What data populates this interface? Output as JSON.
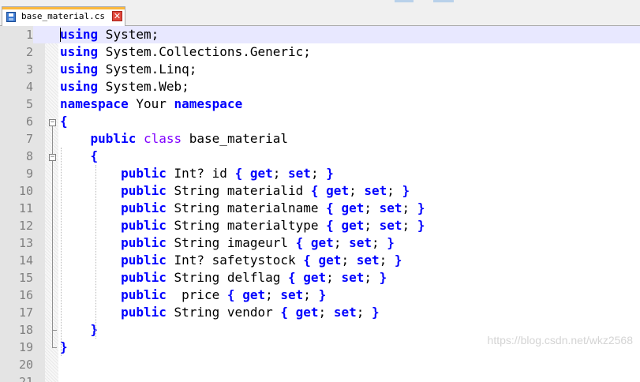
{
  "tab": {
    "title": "base_material.cs",
    "close_symbol": "✕",
    "icon": "save-file-icon"
  },
  "editor": {
    "lines": [
      {
        "n": "1",
        "tokens": [
          {
            "t": "using",
            "c": "kw"
          },
          {
            "t": " System;",
            "c": "id"
          }
        ]
      },
      {
        "n": "2",
        "tokens": [
          {
            "t": "using",
            "c": "kw"
          },
          {
            "t": " System.Collections.Generic;",
            "c": "id"
          }
        ]
      },
      {
        "n": "3",
        "tokens": [
          {
            "t": "using",
            "c": "kw"
          },
          {
            "t": " System.Linq;",
            "c": "id"
          }
        ]
      },
      {
        "n": "4",
        "tokens": [
          {
            "t": "using",
            "c": "kw"
          },
          {
            "t": " System.Web;",
            "c": "id"
          }
        ]
      },
      {
        "n": "5",
        "tokens": [
          {
            "t": "namespace",
            "c": "kw"
          },
          {
            "t": " Your ",
            "c": "id"
          },
          {
            "t": "namespace",
            "c": "kw"
          }
        ]
      },
      {
        "n": "6",
        "tokens": [
          {
            "t": "{",
            "c": "br"
          }
        ]
      },
      {
        "n": "7",
        "tokens": [
          {
            "t": "    ",
            "c": "id"
          },
          {
            "t": "public",
            "c": "kw"
          },
          {
            "t": " ",
            "c": "id"
          },
          {
            "t": "class",
            "c": "ty"
          },
          {
            "t": " base_material",
            "c": "id"
          }
        ]
      },
      {
        "n": "8",
        "tokens": [
          {
            "t": "    ",
            "c": "id"
          },
          {
            "t": "{",
            "c": "br"
          }
        ]
      },
      {
        "n": "9",
        "tokens": [
          {
            "t": "        ",
            "c": "id"
          },
          {
            "t": "public",
            "c": "kw"
          },
          {
            "t": " Int? id ",
            "c": "id"
          },
          {
            "t": "{",
            "c": "br"
          },
          {
            "t": " ",
            "c": "id"
          },
          {
            "t": "get",
            "c": "kw"
          },
          {
            "t": ";",
            "c": "id"
          },
          {
            "t": " ",
            "c": "id"
          },
          {
            "t": "set",
            "c": "kw"
          },
          {
            "t": ";",
            "c": "id"
          },
          {
            "t": " ",
            "c": "id"
          },
          {
            "t": "}",
            "c": "br"
          }
        ]
      },
      {
        "n": "10",
        "tokens": [
          {
            "t": "        ",
            "c": "id"
          },
          {
            "t": "public",
            "c": "kw"
          },
          {
            "t": " String materialid ",
            "c": "id"
          },
          {
            "t": "{",
            "c": "br"
          },
          {
            "t": " ",
            "c": "id"
          },
          {
            "t": "get",
            "c": "kw"
          },
          {
            "t": ";",
            "c": "id"
          },
          {
            "t": " ",
            "c": "id"
          },
          {
            "t": "set",
            "c": "kw"
          },
          {
            "t": ";",
            "c": "id"
          },
          {
            "t": " ",
            "c": "id"
          },
          {
            "t": "}",
            "c": "br"
          }
        ]
      },
      {
        "n": "11",
        "tokens": [
          {
            "t": "        ",
            "c": "id"
          },
          {
            "t": "public",
            "c": "kw"
          },
          {
            "t": " String materialname ",
            "c": "id"
          },
          {
            "t": "{",
            "c": "br"
          },
          {
            "t": " ",
            "c": "id"
          },
          {
            "t": "get",
            "c": "kw"
          },
          {
            "t": ";",
            "c": "id"
          },
          {
            "t": " ",
            "c": "id"
          },
          {
            "t": "set",
            "c": "kw"
          },
          {
            "t": ";",
            "c": "id"
          },
          {
            "t": " ",
            "c": "id"
          },
          {
            "t": "}",
            "c": "br"
          }
        ]
      },
      {
        "n": "12",
        "tokens": [
          {
            "t": "        ",
            "c": "id"
          },
          {
            "t": "public",
            "c": "kw"
          },
          {
            "t": " String materialtype ",
            "c": "id"
          },
          {
            "t": "{",
            "c": "br"
          },
          {
            "t": " ",
            "c": "id"
          },
          {
            "t": "get",
            "c": "kw"
          },
          {
            "t": ";",
            "c": "id"
          },
          {
            "t": " ",
            "c": "id"
          },
          {
            "t": "set",
            "c": "kw"
          },
          {
            "t": ";",
            "c": "id"
          },
          {
            "t": " ",
            "c": "id"
          },
          {
            "t": "}",
            "c": "br"
          }
        ]
      },
      {
        "n": "13",
        "tokens": [
          {
            "t": "        ",
            "c": "id"
          },
          {
            "t": "public",
            "c": "kw"
          },
          {
            "t": " String imageurl ",
            "c": "id"
          },
          {
            "t": "{",
            "c": "br"
          },
          {
            "t": " ",
            "c": "id"
          },
          {
            "t": "get",
            "c": "kw"
          },
          {
            "t": ";",
            "c": "id"
          },
          {
            "t": " ",
            "c": "id"
          },
          {
            "t": "set",
            "c": "kw"
          },
          {
            "t": ";",
            "c": "id"
          },
          {
            "t": " ",
            "c": "id"
          },
          {
            "t": "}",
            "c": "br"
          }
        ]
      },
      {
        "n": "14",
        "tokens": [
          {
            "t": "        ",
            "c": "id"
          },
          {
            "t": "public",
            "c": "kw"
          },
          {
            "t": " Int? safetystock ",
            "c": "id"
          },
          {
            "t": "{",
            "c": "br"
          },
          {
            "t": " ",
            "c": "id"
          },
          {
            "t": "get",
            "c": "kw"
          },
          {
            "t": ";",
            "c": "id"
          },
          {
            "t": " ",
            "c": "id"
          },
          {
            "t": "set",
            "c": "kw"
          },
          {
            "t": ";",
            "c": "id"
          },
          {
            "t": " ",
            "c": "id"
          },
          {
            "t": "}",
            "c": "br"
          }
        ]
      },
      {
        "n": "15",
        "tokens": [
          {
            "t": "        ",
            "c": "id"
          },
          {
            "t": "public",
            "c": "kw"
          },
          {
            "t": " String delflag ",
            "c": "id"
          },
          {
            "t": "{",
            "c": "br"
          },
          {
            "t": " ",
            "c": "id"
          },
          {
            "t": "get",
            "c": "kw"
          },
          {
            "t": ";",
            "c": "id"
          },
          {
            "t": " ",
            "c": "id"
          },
          {
            "t": "set",
            "c": "kw"
          },
          {
            "t": ";",
            "c": "id"
          },
          {
            "t": " ",
            "c": "id"
          },
          {
            "t": "}",
            "c": "br"
          }
        ]
      },
      {
        "n": "16",
        "tokens": [
          {
            "t": "        ",
            "c": "id"
          },
          {
            "t": "public",
            "c": "kw"
          },
          {
            "t": "  price ",
            "c": "id"
          },
          {
            "t": "{",
            "c": "br"
          },
          {
            "t": " ",
            "c": "id"
          },
          {
            "t": "get",
            "c": "kw"
          },
          {
            "t": ";",
            "c": "id"
          },
          {
            "t": " ",
            "c": "id"
          },
          {
            "t": "set",
            "c": "kw"
          },
          {
            "t": ";",
            "c": "id"
          },
          {
            "t": " ",
            "c": "id"
          },
          {
            "t": "}",
            "c": "br"
          }
        ]
      },
      {
        "n": "17",
        "tokens": [
          {
            "t": "        ",
            "c": "id"
          },
          {
            "t": "public",
            "c": "kw"
          },
          {
            "t": " String vendor ",
            "c": "id"
          },
          {
            "t": "{",
            "c": "br"
          },
          {
            "t": " ",
            "c": "id"
          },
          {
            "t": "get",
            "c": "kw"
          },
          {
            "t": ";",
            "c": "id"
          },
          {
            "t": " ",
            "c": "id"
          },
          {
            "t": "set",
            "c": "kw"
          },
          {
            "t": ";",
            "c": "id"
          },
          {
            "t": " ",
            "c": "id"
          },
          {
            "t": "}",
            "c": "br"
          }
        ]
      },
      {
        "n": "18",
        "tokens": [
          {
            "t": "    ",
            "c": "id"
          },
          {
            "t": "}",
            "c": "br"
          }
        ]
      },
      {
        "n": "19",
        "tokens": [
          {
            "t": "}",
            "c": "br"
          }
        ]
      },
      {
        "n": "20",
        "tokens": []
      },
      {
        "n": "21",
        "tokens": []
      }
    ]
  },
  "watermark": "https://blog.csdn.net/wkz2568",
  "colors": {
    "keyword": "#0000ff",
    "type_keyword": "#8000ff",
    "current_line": "#e8e8ff",
    "gutter": "#e4e4e4",
    "tab_accent": "#fbb83b"
  }
}
